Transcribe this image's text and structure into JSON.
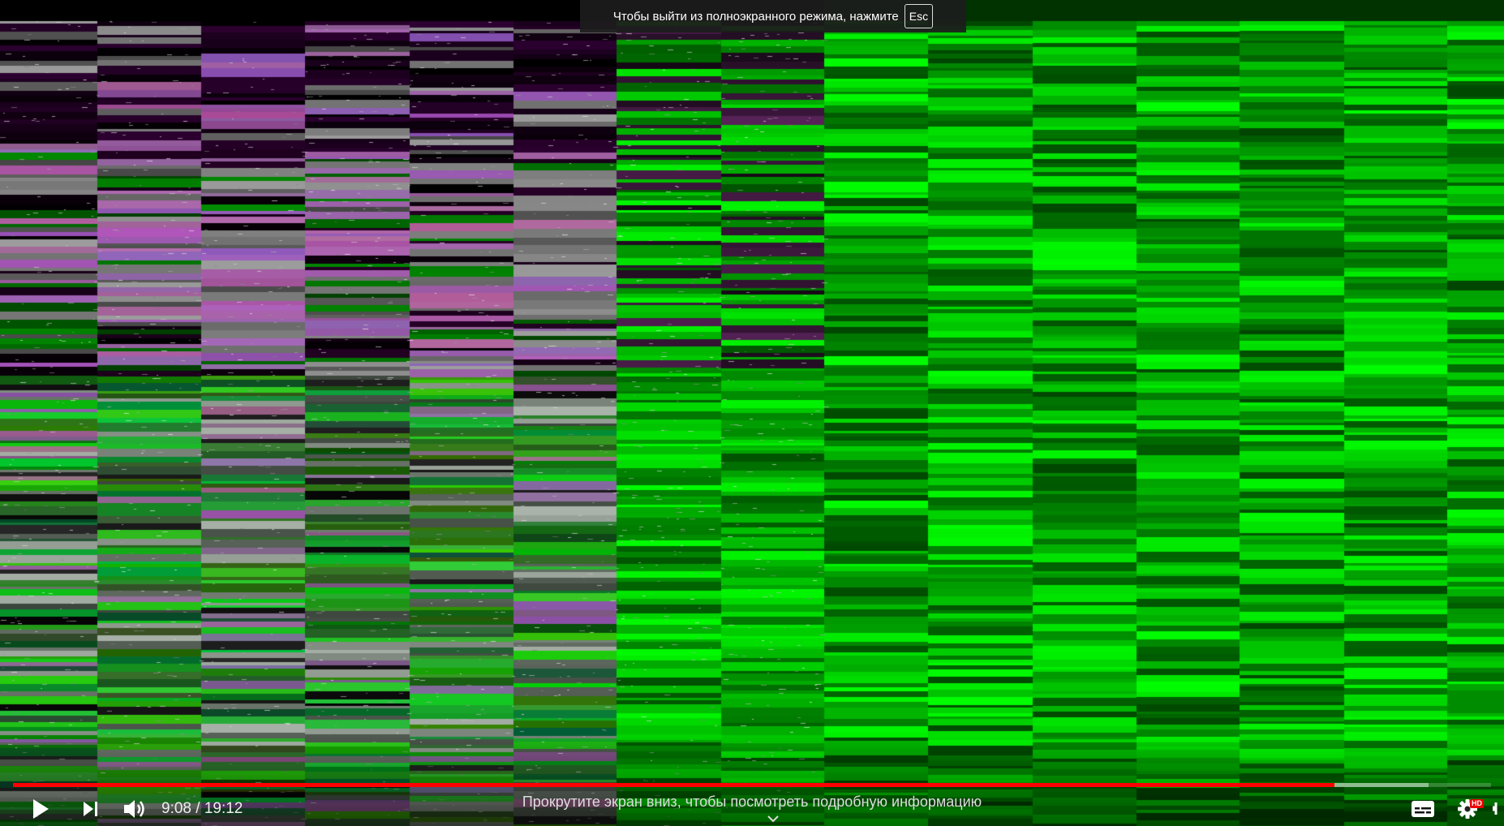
{
  "toast": {
    "message": "Чтобы выйти из полноэкранного режима, нажмите",
    "key": "Esc"
  },
  "player": {
    "time_display": "9:08 / 19:12",
    "progress_played": 0.894,
    "progress_loaded": 0.958,
    "scroll_hint": "Прокрутите экран вниз, чтобы посмотреть подробную информацию",
    "hd_badge": "HD",
    "accent_color": "#ff0000",
    "icons": {
      "play": "play-icon",
      "next": "next-icon",
      "volume": "volume-icon",
      "subtitles": "subtitles-icon",
      "settings": "gear-icon",
      "scroll": "chevron-down-icon",
      "fullscreen_exit": "fullscreen-exit-icon"
    }
  }
}
